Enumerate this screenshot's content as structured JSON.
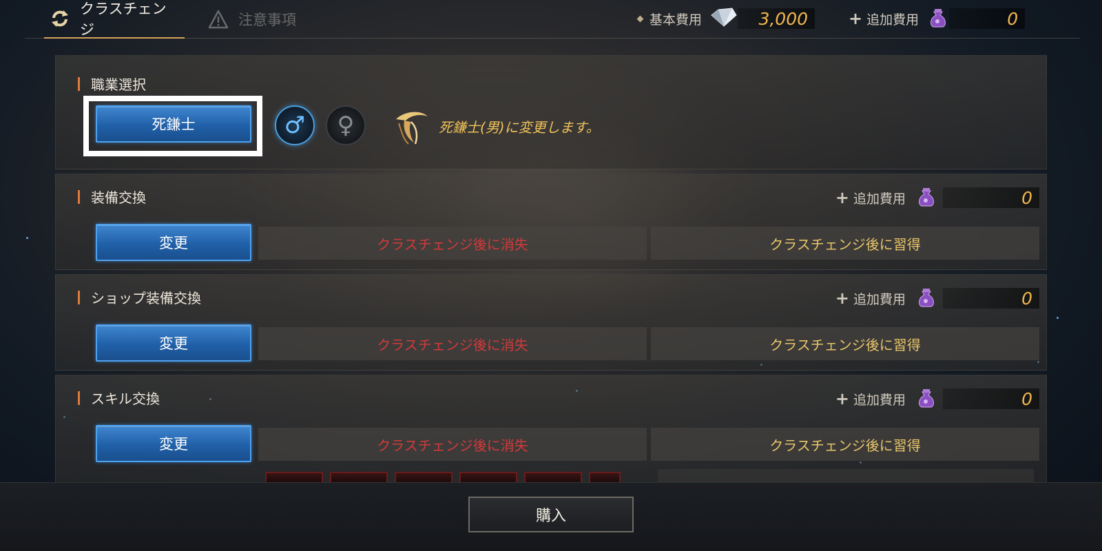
{
  "tabs": [
    {
      "label": "クラスチェンジ",
      "icon": "refresh-icon",
      "active": true
    },
    {
      "label": "注意事項",
      "icon": "warning-icon",
      "active": false
    }
  ],
  "header": {
    "base_cost_label": "基本費用",
    "base_cost_value": "3,000",
    "base_cost_icon": "diamond-currency-icon",
    "add_cost_label": "追加費用",
    "add_cost_value": "0",
    "add_cost_icon": "pouch-currency-icon"
  },
  "job_select": {
    "title": "職業選択",
    "class_button": "死鎌士",
    "male_symbol": "♂",
    "female_symbol": "♀",
    "selected_gender": "male",
    "description": "死鎌士(男)に変更します。"
  },
  "sections": [
    {
      "title": "装備交換",
      "add_cost_label": "追加費用",
      "add_cost_value": "0",
      "button": "変更",
      "lost_label": "クラスチェンジ後に消失",
      "gained_label": "クラスチェンジ後に習得"
    },
    {
      "title": "ショップ装備交換",
      "add_cost_label": "追加費用",
      "add_cost_value": "0",
      "button": "変更",
      "lost_label": "クラスチェンジ後に消失",
      "gained_label": "クラスチェンジ後に習得"
    },
    {
      "title": "スキル交換",
      "add_cost_label": "追加費用",
      "add_cost_value": "0",
      "button": "変更",
      "lost_label": "クラスチェンジ後に消失",
      "gained_label": "クラスチェンジ後に習得"
    }
  ],
  "footer": {
    "buy_button": "購入"
  },
  "colors": {
    "accent_gold": "#f0b54d",
    "button_blue": "#2060a8",
    "lost_red": "#d23a3a",
    "gained_gold": "#e8c56a",
    "title_marker": "#e07a3a"
  }
}
